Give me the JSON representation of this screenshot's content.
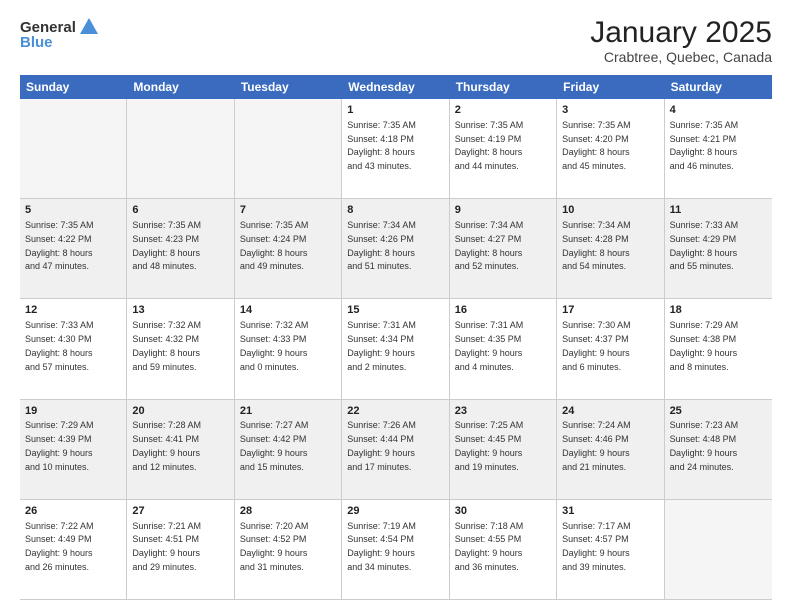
{
  "logo": {
    "general": "General",
    "blue": "Blue"
  },
  "header": {
    "month": "January 2025",
    "location": "Crabtree, Quebec, Canada"
  },
  "weekdays": [
    "Sunday",
    "Monday",
    "Tuesday",
    "Wednesday",
    "Thursday",
    "Friday",
    "Saturday"
  ],
  "weeks": [
    [
      {
        "day": "",
        "info": ""
      },
      {
        "day": "",
        "info": ""
      },
      {
        "day": "",
        "info": ""
      },
      {
        "day": "1",
        "info": "Sunrise: 7:35 AM\nSunset: 4:18 PM\nDaylight: 8 hours\nand 43 minutes."
      },
      {
        "day": "2",
        "info": "Sunrise: 7:35 AM\nSunset: 4:19 PM\nDaylight: 8 hours\nand 44 minutes."
      },
      {
        "day": "3",
        "info": "Sunrise: 7:35 AM\nSunset: 4:20 PM\nDaylight: 8 hours\nand 45 minutes."
      },
      {
        "day": "4",
        "info": "Sunrise: 7:35 AM\nSunset: 4:21 PM\nDaylight: 8 hours\nand 46 minutes."
      }
    ],
    [
      {
        "day": "5",
        "info": "Sunrise: 7:35 AM\nSunset: 4:22 PM\nDaylight: 8 hours\nand 47 minutes."
      },
      {
        "day": "6",
        "info": "Sunrise: 7:35 AM\nSunset: 4:23 PM\nDaylight: 8 hours\nand 48 minutes."
      },
      {
        "day": "7",
        "info": "Sunrise: 7:35 AM\nSunset: 4:24 PM\nDaylight: 8 hours\nand 49 minutes."
      },
      {
        "day": "8",
        "info": "Sunrise: 7:34 AM\nSunset: 4:26 PM\nDaylight: 8 hours\nand 51 minutes."
      },
      {
        "day": "9",
        "info": "Sunrise: 7:34 AM\nSunset: 4:27 PM\nDaylight: 8 hours\nand 52 minutes."
      },
      {
        "day": "10",
        "info": "Sunrise: 7:34 AM\nSunset: 4:28 PM\nDaylight: 8 hours\nand 54 minutes."
      },
      {
        "day": "11",
        "info": "Sunrise: 7:33 AM\nSunset: 4:29 PM\nDaylight: 8 hours\nand 55 minutes."
      }
    ],
    [
      {
        "day": "12",
        "info": "Sunrise: 7:33 AM\nSunset: 4:30 PM\nDaylight: 8 hours\nand 57 minutes."
      },
      {
        "day": "13",
        "info": "Sunrise: 7:32 AM\nSunset: 4:32 PM\nDaylight: 8 hours\nand 59 minutes."
      },
      {
        "day": "14",
        "info": "Sunrise: 7:32 AM\nSunset: 4:33 PM\nDaylight: 9 hours\nand 0 minutes."
      },
      {
        "day": "15",
        "info": "Sunrise: 7:31 AM\nSunset: 4:34 PM\nDaylight: 9 hours\nand 2 minutes."
      },
      {
        "day": "16",
        "info": "Sunrise: 7:31 AM\nSunset: 4:35 PM\nDaylight: 9 hours\nand 4 minutes."
      },
      {
        "day": "17",
        "info": "Sunrise: 7:30 AM\nSunset: 4:37 PM\nDaylight: 9 hours\nand 6 minutes."
      },
      {
        "day": "18",
        "info": "Sunrise: 7:29 AM\nSunset: 4:38 PM\nDaylight: 9 hours\nand 8 minutes."
      }
    ],
    [
      {
        "day": "19",
        "info": "Sunrise: 7:29 AM\nSunset: 4:39 PM\nDaylight: 9 hours\nand 10 minutes."
      },
      {
        "day": "20",
        "info": "Sunrise: 7:28 AM\nSunset: 4:41 PM\nDaylight: 9 hours\nand 12 minutes."
      },
      {
        "day": "21",
        "info": "Sunrise: 7:27 AM\nSunset: 4:42 PM\nDaylight: 9 hours\nand 15 minutes."
      },
      {
        "day": "22",
        "info": "Sunrise: 7:26 AM\nSunset: 4:44 PM\nDaylight: 9 hours\nand 17 minutes."
      },
      {
        "day": "23",
        "info": "Sunrise: 7:25 AM\nSunset: 4:45 PM\nDaylight: 9 hours\nand 19 minutes."
      },
      {
        "day": "24",
        "info": "Sunrise: 7:24 AM\nSunset: 4:46 PM\nDaylight: 9 hours\nand 21 minutes."
      },
      {
        "day": "25",
        "info": "Sunrise: 7:23 AM\nSunset: 4:48 PM\nDaylight: 9 hours\nand 24 minutes."
      }
    ],
    [
      {
        "day": "26",
        "info": "Sunrise: 7:22 AM\nSunset: 4:49 PM\nDaylight: 9 hours\nand 26 minutes."
      },
      {
        "day": "27",
        "info": "Sunrise: 7:21 AM\nSunset: 4:51 PM\nDaylight: 9 hours\nand 29 minutes."
      },
      {
        "day": "28",
        "info": "Sunrise: 7:20 AM\nSunset: 4:52 PM\nDaylight: 9 hours\nand 31 minutes."
      },
      {
        "day": "29",
        "info": "Sunrise: 7:19 AM\nSunset: 4:54 PM\nDaylight: 9 hours\nand 34 minutes."
      },
      {
        "day": "30",
        "info": "Sunrise: 7:18 AM\nSunset: 4:55 PM\nDaylight: 9 hours\nand 36 minutes."
      },
      {
        "day": "31",
        "info": "Sunrise: 7:17 AM\nSunset: 4:57 PM\nDaylight: 9 hours\nand 39 minutes."
      },
      {
        "day": "",
        "info": ""
      }
    ]
  ]
}
